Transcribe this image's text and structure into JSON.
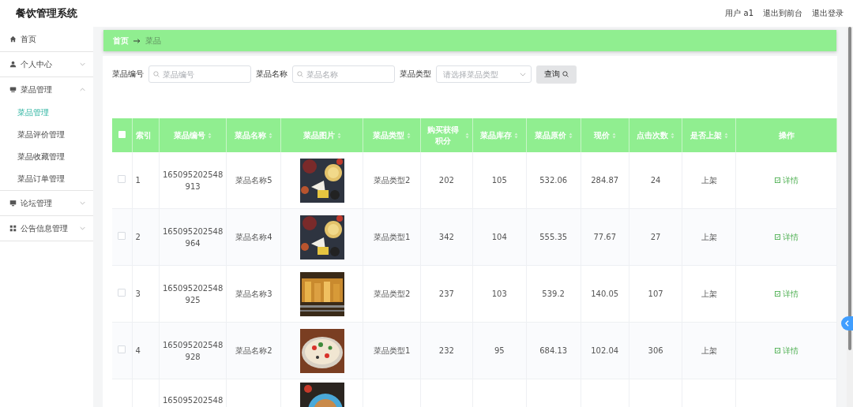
{
  "header": {
    "title": "餐饮管理系统",
    "links": [
      "用户 a1",
      "退出到前台",
      "退出登录"
    ]
  },
  "sidebar": {
    "items": [
      {
        "label": "首页",
        "selected": false
      },
      {
        "label": "个人中心",
        "expanded": false,
        "selected": false
      },
      {
        "label": "菜品管理",
        "expanded": true,
        "selected": false,
        "children": [
          {
            "label": "菜品管理",
            "selected": true
          },
          {
            "label": "菜品评价管理",
            "selected": false
          },
          {
            "label": "菜品收藏管理",
            "selected": false
          },
          {
            "label": "菜品订单管理",
            "selected": false
          }
        ]
      },
      {
        "label": "论坛管理",
        "expanded": false,
        "selected": false
      },
      {
        "label": "公告信息管理",
        "expanded": false,
        "selected": false
      }
    ]
  },
  "breadcrumb": [
    "首页",
    "菜品"
  ],
  "search": {
    "fields": [
      {
        "kind": "text",
        "label": "菜品编号",
        "placeholder": "菜品编号"
      },
      {
        "kind": "text",
        "label": "菜品名称",
        "placeholder": "菜品名称"
      },
      {
        "kind": "select",
        "label": "菜品类型",
        "placeholder": "请选择菜品类型"
      }
    ],
    "button": "查询"
  },
  "table": {
    "header_checked": false,
    "columns": [
      {
        "label": "索引",
        "sortable": false
      },
      {
        "label": "菜品编号",
        "sortable": true
      },
      {
        "label": "菜品名称",
        "sortable": true
      },
      {
        "label": "菜品图片",
        "sortable": true
      },
      {
        "label": "菜品类型",
        "sortable": true
      },
      {
        "label": "购买获得积分",
        "sortable": true
      },
      {
        "label": "菜品库存",
        "sortable": true
      },
      {
        "label": "菜品原价",
        "sortable": true
      },
      {
        "label": "现价",
        "sortable": true
      },
      {
        "label": "点击次数",
        "sortable": true
      },
      {
        "label": "是否上架",
        "sortable": true
      },
      {
        "label": "操作",
        "sortable": false
      }
    ],
    "rows": [
      {
        "checked": false,
        "index": "1",
        "id": "165095202548913",
        "name": "菜品名称5",
        "type": "菜品类型2",
        "points": "202",
        "stock": "105",
        "price": "532.06",
        "now": "284.87",
        "clicks": "24",
        "status": "上架",
        "action": "详情"
      },
      {
        "checked": false,
        "index": "2",
        "id": "165095202548964",
        "name": "菜品名称4",
        "type": "菜品类型1",
        "points": "342",
        "stock": "104",
        "price": "555.35",
        "now": "77.67",
        "clicks": "27",
        "status": "上架",
        "action": "详情"
      },
      {
        "checked": false,
        "index": "3",
        "id": "165095202548925",
        "name": "菜品名称3",
        "type": "菜品类型2",
        "points": "237",
        "stock": "103",
        "price": "539.2",
        "now": "140.05",
        "clicks": "107",
        "status": "上架",
        "action": "详情"
      },
      {
        "checked": false,
        "index": "4",
        "id": "165095202548928",
        "name": "菜品名称2",
        "type": "菜品类型1",
        "points": "232",
        "stock": "95",
        "price": "684.13",
        "now": "102.04",
        "clicks": "306",
        "status": "上架",
        "action": "详情"
      },
      {
        "id": "165095202548"
      }
    ]
  }
}
